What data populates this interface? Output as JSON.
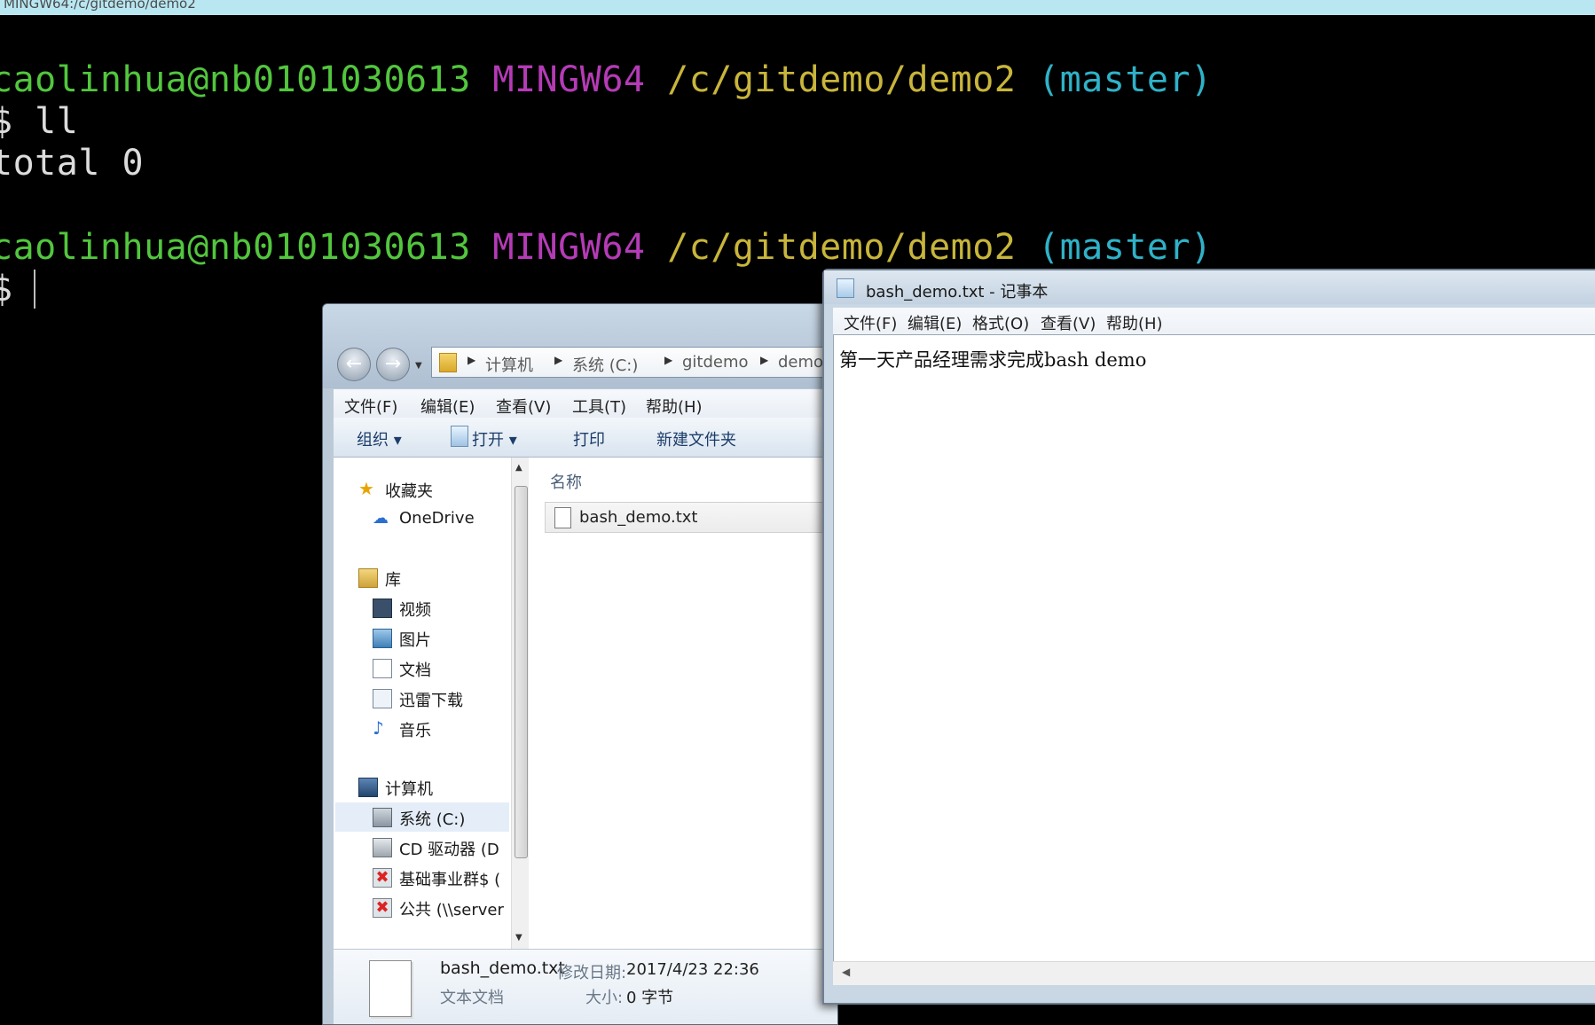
{
  "terminal": {
    "title": "MINGW64:/c/gitdemo/demo2",
    "prompt1": {
      "user": "caolinhua@nb0101030613",
      "shell": "MINGW64",
      "path": "/c/gitdemo/demo2",
      "branch": "(master)"
    },
    "command": "$ ll",
    "output": "total 0",
    "prompt2": {
      "user": "caolinhua@nb0101030613",
      "shell": "MINGW64",
      "path": "/c/gitdemo/demo2",
      "branch": "(master)"
    },
    "cursor_prompt": "$"
  },
  "explorer": {
    "address": [
      "计算机",
      "系统 (C:)",
      "gitdemo",
      "demo2"
    ],
    "menu": [
      "文件(F)",
      "编辑(E)",
      "查看(V)",
      "工具(T)",
      "帮助(H)"
    ],
    "toolbar": {
      "organize": "组织 ▾",
      "open": "打开 ▾",
      "print": "打印",
      "new_folder": "新建文件夹"
    },
    "nav": {
      "favorites": "收藏夹",
      "onedrive": "OneDrive",
      "libraries": "库",
      "videos": "视频",
      "pictures": "图片",
      "documents": "文档",
      "thunder": "迅雷下载",
      "music": "音乐",
      "computer": "计算机",
      "drive_c": "系统 (C:)",
      "cd_drive": "CD 驱动器 (D",
      "net1": "基础事业群$ (",
      "net2": "公共 (\\\\server"
    },
    "column_name": "名称",
    "files": [
      {
        "name": "bash_demo.txt"
      }
    ],
    "details": {
      "filename": "bash_demo.txt",
      "modified_label": "修改日期:",
      "modified": "2017/4/23 22:36",
      "type": "文本文档",
      "size_label": "大小:",
      "size": "0 字节"
    }
  },
  "notepad": {
    "title": "bash_demo.txt - 记事本",
    "menu": [
      "文件(F)",
      "编辑(E)",
      "格式(O)",
      "查看(V)",
      "帮助(H)"
    ],
    "content": "第一天产品经理需求完成bash demo"
  }
}
